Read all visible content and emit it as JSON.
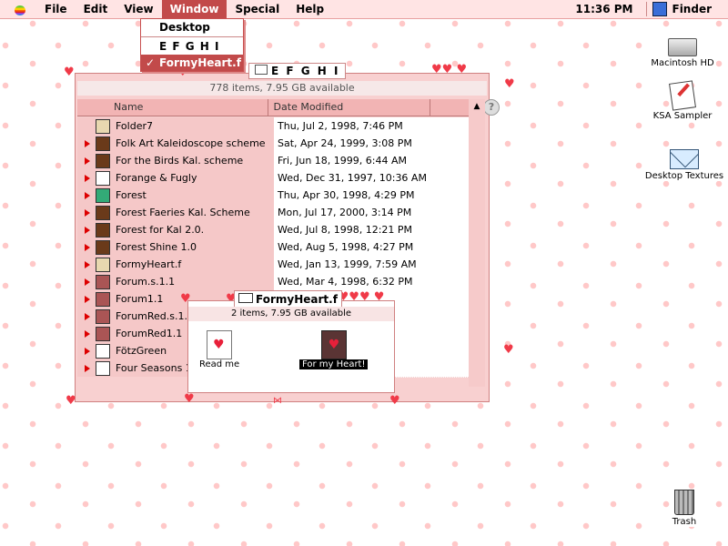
{
  "menubar": {
    "items": [
      "File",
      "Edit",
      "View",
      "Window",
      "Special",
      "Help"
    ],
    "clock": "11:36 PM",
    "app": "Finder"
  },
  "window_menu": {
    "items": [
      {
        "label": "Desktop",
        "checked": false,
        "selected": false
      },
      {
        "label": "E F G H I",
        "checked": false,
        "selected": false
      },
      {
        "label": "FormyHeart.f",
        "checked": true,
        "selected": true
      }
    ]
  },
  "desktop_icons": {
    "hd": "Macintosh HD",
    "ksa": "KSA Sampler",
    "textures": "Desktop Textures",
    "trash": "Trash"
  },
  "main_window": {
    "title": "E F G H I",
    "info": "778 items, 7.95 GB available",
    "columns": [
      "Name",
      "Date Modified"
    ],
    "rows": [
      {
        "name": "Folder7",
        "date": "Thu, Jul 2, 1998, 7:46 PM",
        "folder": false,
        "icon": "folder-icon"
      },
      {
        "name": "Folk Art Kaleidoscope scheme",
        "date": "Sat, Apr 24, 1999, 3:08 PM",
        "folder": true,
        "icon": "scheme-icon"
      },
      {
        "name": "For the Birds Kal. scheme",
        "date": "Fri, Jun 18, 1999, 6:44 AM",
        "folder": true,
        "icon": "scheme-icon"
      },
      {
        "name": "Forange & Fugly",
        "date": "Wed, Dec 31, 1997, 10:36 AM",
        "folder": true,
        "icon": "envelope-icon"
      },
      {
        "name": "Forest",
        "date": "Thu, Apr 30, 1998, 4:29 PM",
        "folder": true,
        "icon": "tree-icon"
      },
      {
        "name": "Forest Faeries Kal. Scheme",
        "date": "Mon, Jul 17, 2000, 3:14 PM",
        "folder": true,
        "icon": "scheme-icon"
      },
      {
        "name": "Forest for Kal 2.0.",
        "date": "Wed, Jul 8, 1998, 12:21 PM",
        "folder": true,
        "icon": "scheme-icon"
      },
      {
        "name": "Forest Shine 1.0",
        "date": "Wed, Aug 5, 1998, 4:27 PM",
        "folder": true,
        "icon": "scheme-icon"
      },
      {
        "name": "FormyHeart.f",
        "date": "Wed, Jan 13, 1999, 7:59 AM",
        "folder": true,
        "icon": "folder-icon"
      },
      {
        "name": "Forum.s.1.1",
        "date": "Wed, Mar 4, 1998, 6:32 PM",
        "folder": true,
        "icon": "forum-icon"
      },
      {
        "name": "Forum1.1",
        "date": "",
        "folder": true,
        "icon": "forum-icon"
      },
      {
        "name": "ForumRed.s.1.1",
        "date": "",
        "folder": true,
        "icon": "forum-icon"
      },
      {
        "name": "ForumRed1.1",
        "date": "",
        "folder": true,
        "icon": "forum-icon"
      },
      {
        "name": "FötzGreen",
        "date": "",
        "folder": true,
        "icon": "envelope-icon"
      },
      {
        "name": "Four Seasons 1.",
        "date": "",
        "folder": true,
        "icon": "envelope-icon"
      }
    ]
  },
  "second_window": {
    "title": "FormyHeart.f",
    "info": "2 items, 7.95 GB available",
    "items": [
      "Read me",
      "For my Heart!"
    ]
  }
}
